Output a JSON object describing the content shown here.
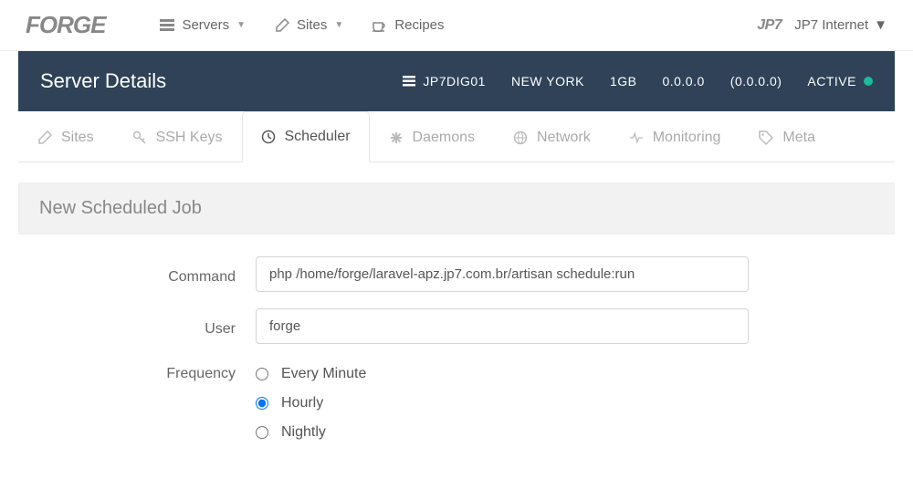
{
  "brand": "FORGE",
  "nav": {
    "servers": "Servers",
    "sites": "Sites",
    "recipes": "Recipes"
  },
  "account": {
    "logo": "JP7",
    "name": "JP7 Internet"
  },
  "server": {
    "title": "Server Details",
    "name": "JP7DIG01",
    "region": "NEW YORK",
    "size": "1GB",
    "ip": "0.0.0.0",
    "private_ip": "(0.0.0.0)",
    "status": "ACTIVE"
  },
  "tabs": {
    "sites": "Sites",
    "ssh_keys": "SSH Keys",
    "scheduler": "Scheduler",
    "daemons": "Daemons",
    "network": "Network",
    "monitoring": "Monitoring",
    "meta": "Meta"
  },
  "panel": {
    "title": "New Scheduled Job"
  },
  "form": {
    "command_label": "Command",
    "command_value": "php /home/forge/laravel-apz.jp7.com.br/artisan schedule:run",
    "user_label": "User",
    "user_value": "forge",
    "frequency_label": "Frequency",
    "frequency_options": {
      "every_minute": "Every Minute",
      "hourly": "Hourly",
      "nightly": "Nightly"
    },
    "frequency_selected": "hourly"
  }
}
